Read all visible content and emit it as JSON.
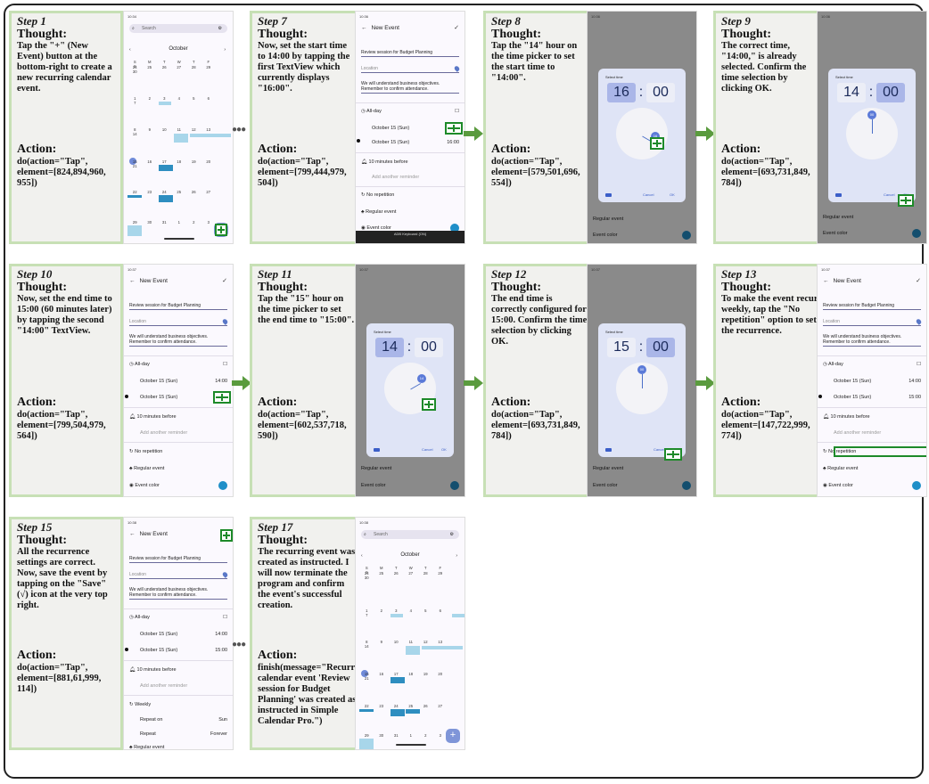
{
  "steps": [
    {
      "step": "Step 1",
      "thought_label": "Thought:",
      "thought": "Tap the \"+\" (New Event) button at the bottom-right to create a new recurring calendar event.",
      "action_label": "Action:",
      "action": "do(action=\"Tap\", element=[824,894,960, 955])"
    },
    {
      "step": "Step 7",
      "thought_label": "Thought:",
      "thought": "Now, set the start time to 14:00 by tapping the first TextView which currently displays \"16:00\".",
      "action_label": "Action:",
      "action": "do(action=\"Tap\", element=[799,444,979, 504])"
    },
    {
      "step": "Step 8",
      "thought_label": "Thought:",
      "thought": "Tap the \"14\" hour on the time picker to set the start time to \"14:00\".",
      "action_label": "Action:",
      "action": "do(action=\"Tap\", element=[579,501,696, 554])"
    },
    {
      "step": "Step 9",
      "thought_label": "Thought:",
      "thought": "The correct time, \"14:00,\" is already selected. Confirm the time selection by clicking OK.",
      "action_label": "Action:",
      "action": "do(action=\"Tap\", element=[693,731,849, 784])"
    },
    {
      "step": "Step 10",
      "thought_label": "Thought:",
      "thought": "Now, set the end time to 15:00 (60 minutes later) by tapping the second \"14:00\" TextView.",
      "action_label": "Action:",
      "action": "do(action=\"Tap\", element=[799,504,979, 564])"
    },
    {
      "step": "Step 11",
      "thought_label": "Thought:",
      "thought": "Tap the \"15\" hour on the time picker to set the end time to \"15:00\".",
      "action_label": "Action:",
      "action": "do(action=\"Tap\", element=[602,537,718, 590])"
    },
    {
      "step": "Step 12",
      "thought_label": "Thought:",
      "thought": "The end time is correctly configured for 15:00. Confirm the time selection by clicking OK.",
      "action_label": "Action:",
      "action": "do(action=\"Tap\", element=[693,731,849, 784])"
    },
    {
      "step": "Step 13",
      "thought_label": "Thought:",
      "thought": "To make the event recur weekly, tap the \"No repetition\" option to set the recurrence.",
      "action_label": "Action:",
      "action": "do(action=\"Tap\", element=[147,722,999, 774])"
    },
    {
      "step": "Step 15",
      "thought_label": "Thought:",
      "thought": "All the recurrence settings are correct. Now, save the event by tapping on the \"Save\" (√) icon at the very top right.",
      "action_label": "Action:",
      "action": "do(action=\"Tap\", element=[881,61,999, 114])"
    },
    {
      "step": "Step 17",
      "thought_label": "Thought:",
      "thought": "The recurring event was created as instructed. I will now terminate the program and confirm the event's successful creation.",
      "action_label": "Action:",
      "action": "finish(message=\"Recurring calendar event 'Review session for Budget Planning' was created as instructed in Simple Calendar Pro.\")"
    }
  ],
  "calendar": {
    "search_placeholder": "Search",
    "month": "October",
    "weekdays": [
      "S",
      "M",
      "T",
      "W",
      "T",
      "F",
      "S"
    ],
    "weeks": [
      [
        "24",
        "25",
        "26",
        "27",
        "28",
        "29",
        "30"
      ],
      [
        "1",
        "2",
        "3",
        "4",
        "5",
        "6",
        "7"
      ],
      [
        "8",
        "9",
        "10",
        "11",
        "12",
        "13",
        "14"
      ],
      [
        "15",
        "16",
        "17",
        "18",
        "19",
        "20",
        "21"
      ],
      [
        "22",
        "23",
        "24",
        "25",
        "26",
        "27",
        "28"
      ],
      [
        "29",
        "30",
        "31",
        "1",
        "2",
        "3",
        "4"
      ]
    ],
    "fab_label": "+"
  },
  "event_form": {
    "screen_title": "New Event",
    "title_value": "Review session for Budget Planning",
    "location_placeholder": "Location",
    "description": "We will understand business objectives. Remember to confirm attendance.",
    "all_day": "All-day",
    "start_date": "October 15 (Sun)",
    "end_date": "October 15 (Sun)",
    "start_time_initial": "16:00",
    "start_time_set": "14:00",
    "end_time_set": "15:00",
    "reminder": "10 minutes before",
    "add_reminder": "Add another reminder",
    "repetition_none": "No repetition",
    "repetition_weekly": "Weekly",
    "repeat_on_label": "Repeat on",
    "repeat_on_value": "Sun",
    "repeat_label": "Repeat",
    "repeat_value": "Forever",
    "event_type": "Regular event",
    "event_color": "Event color",
    "keyboard_bar": "ADB Keyboard {ON}"
  },
  "time_picker": {
    "title": "Select time",
    "hour_14": "14",
    "hour_15": "15",
    "hour_16": "16",
    "minutes": "00",
    "colon": ":",
    "cancel": "Cancel",
    "ok": "OK"
  },
  "status_bar": {
    "time_a": "10:34",
    "time_b": "10:36",
    "time_c": "10:37",
    "time_d": "10:38"
  }
}
